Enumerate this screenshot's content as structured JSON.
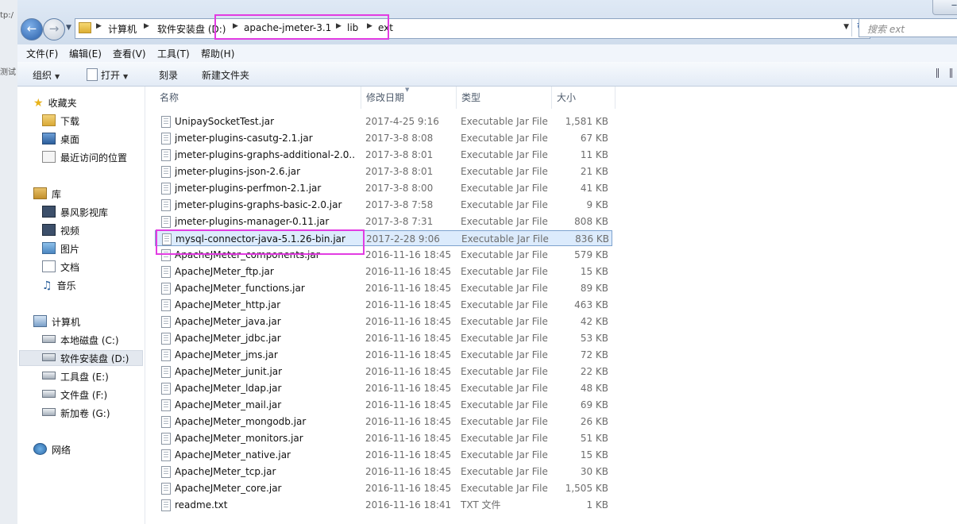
{
  "address": {
    "crumbs": [
      "计算机",
      "软件安装盘 (D:)",
      "apache-jmeter-3.1",
      "lib",
      "ext"
    ],
    "search_placeholder": "搜索 ext"
  },
  "left_strip_text": [
    "tp:/",
    "测试"
  ],
  "menu": [
    "文件(F)",
    "编辑(E)",
    "查看(V)",
    "工具(T)",
    "帮助(H)"
  ],
  "toolbar": {
    "organize": "组织",
    "open": "打开",
    "burn": "刻录",
    "new_folder": "新建文件夹"
  },
  "nav": {
    "favorites": {
      "label": "收藏夹",
      "items": [
        "下载",
        "桌面",
        "最近访问的位置"
      ]
    },
    "libraries": {
      "label": "库",
      "items": [
        "暴风影视库",
        "视频",
        "图片",
        "文档",
        "音乐"
      ]
    },
    "computer": {
      "label": "计算机",
      "items": [
        "本地磁盘 (C:)",
        "软件安装盘 (D:)",
        "工具盘 (E:)",
        "文件盘 (F:)",
        "新加卷 (G:)"
      ]
    },
    "network": {
      "label": "网络"
    }
  },
  "columns": {
    "name": "名称",
    "date": "修改日期",
    "type": "类型",
    "size": "大小"
  },
  "files": [
    {
      "name": "UnipaySocketTest.jar",
      "date": "2017-4-25 9:16",
      "type": "Executable Jar File",
      "size": "1,581 KB"
    },
    {
      "name": "jmeter-plugins-casutg-2.1.jar",
      "date": "2017-3-8 8:08",
      "type": "Executable Jar File",
      "size": "67 KB"
    },
    {
      "name": "jmeter-plugins-graphs-additional-2.0...",
      "date": "2017-3-8 8:01",
      "type": "Executable Jar File",
      "size": "11 KB"
    },
    {
      "name": "jmeter-plugins-json-2.6.jar",
      "date": "2017-3-8 8:01",
      "type": "Executable Jar File",
      "size": "21 KB"
    },
    {
      "name": "jmeter-plugins-perfmon-2.1.jar",
      "date": "2017-3-8 8:00",
      "type": "Executable Jar File",
      "size": "41 KB"
    },
    {
      "name": "jmeter-plugins-graphs-basic-2.0.jar",
      "date": "2017-3-8 7:58",
      "type": "Executable Jar File",
      "size": "9 KB"
    },
    {
      "name": "jmeter-plugins-manager-0.11.jar",
      "date": "2017-3-8 7:31",
      "type": "Executable Jar File",
      "size": "808 KB"
    },
    {
      "name": "mysql-connector-java-5.1.26-bin.jar",
      "date": "2017-2-28 9:06",
      "type": "Executable Jar File",
      "size": "836 KB"
    },
    {
      "name": "ApacheJMeter_components.jar",
      "date": "2016-11-16 18:45",
      "type": "Executable Jar File",
      "size": "579 KB"
    },
    {
      "name": "ApacheJMeter_ftp.jar",
      "date": "2016-11-16 18:45",
      "type": "Executable Jar File",
      "size": "15 KB"
    },
    {
      "name": "ApacheJMeter_functions.jar",
      "date": "2016-11-16 18:45",
      "type": "Executable Jar File",
      "size": "89 KB"
    },
    {
      "name": "ApacheJMeter_http.jar",
      "date": "2016-11-16 18:45",
      "type": "Executable Jar File",
      "size": "463 KB"
    },
    {
      "name": "ApacheJMeter_java.jar",
      "date": "2016-11-16 18:45",
      "type": "Executable Jar File",
      "size": "42 KB"
    },
    {
      "name": "ApacheJMeter_jdbc.jar",
      "date": "2016-11-16 18:45",
      "type": "Executable Jar File",
      "size": "53 KB"
    },
    {
      "name": "ApacheJMeter_jms.jar",
      "date": "2016-11-16 18:45",
      "type": "Executable Jar File",
      "size": "72 KB"
    },
    {
      "name": "ApacheJMeter_junit.jar",
      "date": "2016-11-16 18:45",
      "type": "Executable Jar File",
      "size": "22 KB"
    },
    {
      "name": "ApacheJMeter_ldap.jar",
      "date": "2016-11-16 18:45",
      "type": "Executable Jar File",
      "size": "48 KB"
    },
    {
      "name": "ApacheJMeter_mail.jar",
      "date": "2016-11-16 18:45",
      "type": "Executable Jar File",
      "size": "69 KB"
    },
    {
      "name": "ApacheJMeter_mongodb.jar",
      "date": "2016-11-16 18:45",
      "type": "Executable Jar File",
      "size": "26 KB"
    },
    {
      "name": "ApacheJMeter_monitors.jar",
      "date": "2016-11-16 18:45",
      "type": "Executable Jar File",
      "size": "51 KB"
    },
    {
      "name": "ApacheJMeter_native.jar",
      "date": "2016-11-16 18:45",
      "type": "Executable Jar File",
      "size": "15 KB"
    },
    {
      "name": "ApacheJMeter_tcp.jar",
      "date": "2016-11-16 18:45",
      "type": "Executable Jar File",
      "size": "30 KB"
    },
    {
      "name": "ApacheJMeter_core.jar",
      "date": "2016-11-16 18:45",
      "type": "Executable Jar File",
      "size": "1,505 KB"
    },
    {
      "name": "readme.txt",
      "date": "2016-11-16 18:41",
      "type": "TXT 文件",
      "size": "1 KB"
    }
  ],
  "selected_index": 7,
  "highlight_color": "#e23ce2"
}
